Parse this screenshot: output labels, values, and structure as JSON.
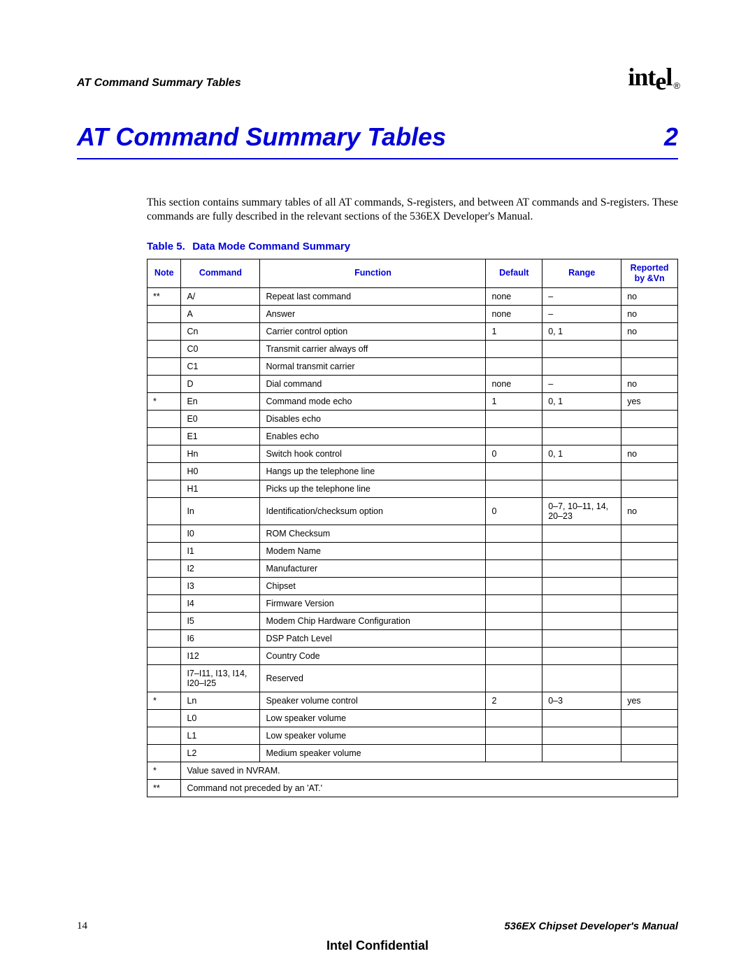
{
  "header": {
    "running_title": "AT Command Summary Tables",
    "logo_text": "intel",
    "logo_reg": "®"
  },
  "title": {
    "text": "AT Command Summary Tables",
    "chapter": "2"
  },
  "intro": "This section contains summary tables of all AT commands, S-registers, and between AT commands and S-registers. These commands are fully described in the relevant sections of the 536EX Developer's Manual.",
  "table_caption": {
    "label": "Table 5.",
    "text": "Data Mode Command Summary"
  },
  "headers": {
    "note": "Note",
    "command": "Command",
    "function": "Function",
    "default": "Default",
    "range": "Range",
    "reported": "Reported by &Vn"
  },
  "rows": [
    {
      "note": "**",
      "cmd": "A/",
      "func": "Repeat last command",
      "def": "none",
      "range": "–",
      "rep": "no"
    },
    {
      "note": "",
      "cmd": "A",
      "func": "Answer",
      "def": "none",
      "range": "–",
      "rep": "no"
    },
    {
      "note": "",
      "cmd": "Cn",
      "func": "Carrier control option",
      "def": "1",
      "range": "0, 1",
      "rep": "no"
    },
    {
      "note": "",
      "cmd": "C0",
      "indent": true,
      "func": "Transmit carrier always off",
      "def": "",
      "range": "",
      "rep": ""
    },
    {
      "note": "",
      "cmd": "C1",
      "indent": true,
      "func": "Normal transmit carrier",
      "def": "",
      "range": "",
      "rep": ""
    },
    {
      "note": "",
      "cmd": "D",
      "func": "Dial command",
      "def": "none",
      "range": "–",
      "rep": "no"
    },
    {
      "note": "*",
      "cmd": "En",
      "func": "Command mode echo",
      "def": "1",
      "range": "0, 1",
      "rep": "yes"
    },
    {
      "note": "",
      "cmd": "E0",
      "indent": true,
      "func": "Disables echo",
      "def": "",
      "range": "",
      "rep": ""
    },
    {
      "note": "",
      "cmd": "E1",
      "indent": true,
      "func": "Enables echo",
      "def": "",
      "range": "",
      "rep": ""
    },
    {
      "note": "",
      "cmd": "Hn",
      "func": "Switch hook control",
      "def": "0",
      "range": "0, 1",
      "rep": "no"
    },
    {
      "note": "",
      "cmd": "H0",
      "indent": true,
      "func": "Hangs up the telephone line",
      "def": "",
      "range": "",
      "rep": ""
    },
    {
      "note": "",
      "cmd": "H1",
      "indent": true,
      "func": "Picks up the telephone line",
      "def": "",
      "range": "",
      "rep": ""
    },
    {
      "note": "",
      "cmd": "In",
      "func": "Identification/checksum option",
      "def": "0",
      "range": "0–7, 10–11, 14, 20–23",
      "rep": "no"
    },
    {
      "note": "",
      "cmd": "I0",
      "indent": true,
      "func": "ROM Checksum",
      "def": "",
      "range": "",
      "rep": ""
    },
    {
      "note": "",
      "cmd": "I1",
      "indent": true,
      "func": "Modem Name",
      "def": "",
      "range": "",
      "rep": ""
    },
    {
      "note": "",
      "cmd": "I2",
      "indent": true,
      "func": "Manufacturer",
      "def": "",
      "range": "",
      "rep": ""
    },
    {
      "note": "",
      "cmd": "I3",
      "indent": true,
      "func": "Chipset",
      "def": "",
      "range": "",
      "rep": ""
    },
    {
      "note": "",
      "cmd": "I4",
      "indent": true,
      "func": "Firmware Version",
      "def": "",
      "range": "",
      "rep": ""
    },
    {
      "note": "",
      "cmd": "I5",
      "indent": true,
      "func": "Modem Chip Hardware Configuration",
      "def": "",
      "range": "",
      "rep": ""
    },
    {
      "note": "",
      "cmd": "I6",
      "indent": true,
      "func": "DSP Patch Level",
      "def": "",
      "range": "",
      "rep": ""
    },
    {
      "note": "",
      "cmd": "I12",
      "indent": true,
      "func": "Country Code",
      "def": "",
      "range": "",
      "rep": ""
    },
    {
      "note": "",
      "cmd": "I7–I11, I13, I14, I20–I25",
      "indent": true,
      "func": "Reserved",
      "def": "",
      "range": "",
      "rep": ""
    },
    {
      "note": "*",
      "cmd": "Ln",
      "func": "Speaker volume control",
      "def": "2",
      "range": "0–3",
      "rep": "yes"
    },
    {
      "note": "",
      "cmd": "L0",
      "indent": true,
      "func": "Low speaker volume",
      "def": "",
      "range": "",
      "rep": ""
    },
    {
      "note": "",
      "cmd": "L1",
      "indent": true,
      "func": "Low speaker volume",
      "def": "",
      "range": "",
      "rep": ""
    },
    {
      "note": "",
      "cmd": "L2",
      "indent": true,
      "func": "Medium speaker volume",
      "def": "",
      "range": "",
      "rep": ""
    }
  ],
  "footnotes": [
    {
      "key": "*",
      "text": "Value saved in NVRAM."
    },
    {
      "key": "**",
      "text": "Command not preceded by an 'AT.'"
    }
  ],
  "footer": {
    "page": "14",
    "manual": "536EX Chipset Developer's Manual",
    "confidential": "Intel Confidential"
  }
}
